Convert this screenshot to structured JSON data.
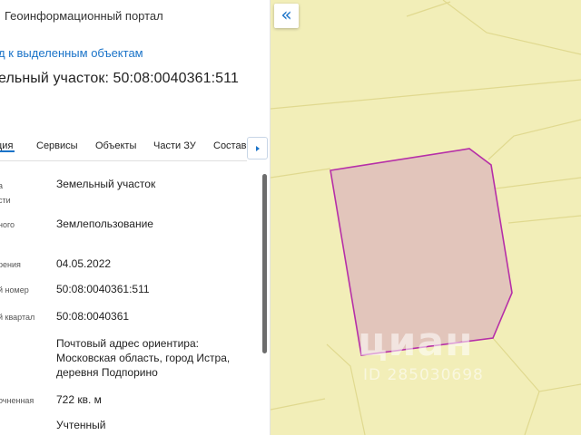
{
  "panel": {
    "portal_title": "Геоинформационный портал",
    "back_link": "д к выделенным объектам",
    "parcel_title": "ельный участок: 50:08:0040361:511",
    "tabs": [
      {
        "label": "ция",
        "active": true
      },
      {
        "label": "Сервисы",
        "active": false
      },
      {
        "label": "Объекты",
        "active": false
      },
      {
        "label": "Части ЗУ",
        "active": false
      },
      {
        "label": "Состав",
        "active": false
      }
    ],
    "tab_scroll_icon": "chevron-right-icon",
    "rows": [
      {
        "label": "а\nсти",
        "value": "Земельный участок"
      },
      {
        "label": "ного",
        "value": "Землепользование"
      },
      {
        "label": "рения",
        "value": "04.05.2022"
      },
      {
        "label": "й номер",
        "value": "50:08:0040361:511"
      },
      {
        "label": "й квартал",
        "value": "50:08:0040361"
      },
      {
        "label": "",
        "value": "Почтовый адрес ориентира:\nМосковская область, город Истра,\nдеревня Подпорино"
      },
      {
        "label": "очненная",
        "value": "722 кв. м"
      },
      {
        "label": "",
        "value": "Учтенный"
      }
    ]
  },
  "map": {
    "collapse_icon": "double-chevron-left-icon",
    "collapse_symbol": "«",
    "watermark_logo": "циан",
    "watermark_id": "ID 285030698",
    "colors": {
      "background": "#f2eeb8",
      "parcel_fill": "#e2c5bb",
      "parcel_stroke": "#b62fa8",
      "boundaries": "#e0d98f",
      "accent": "#1a73c8"
    }
  }
}
